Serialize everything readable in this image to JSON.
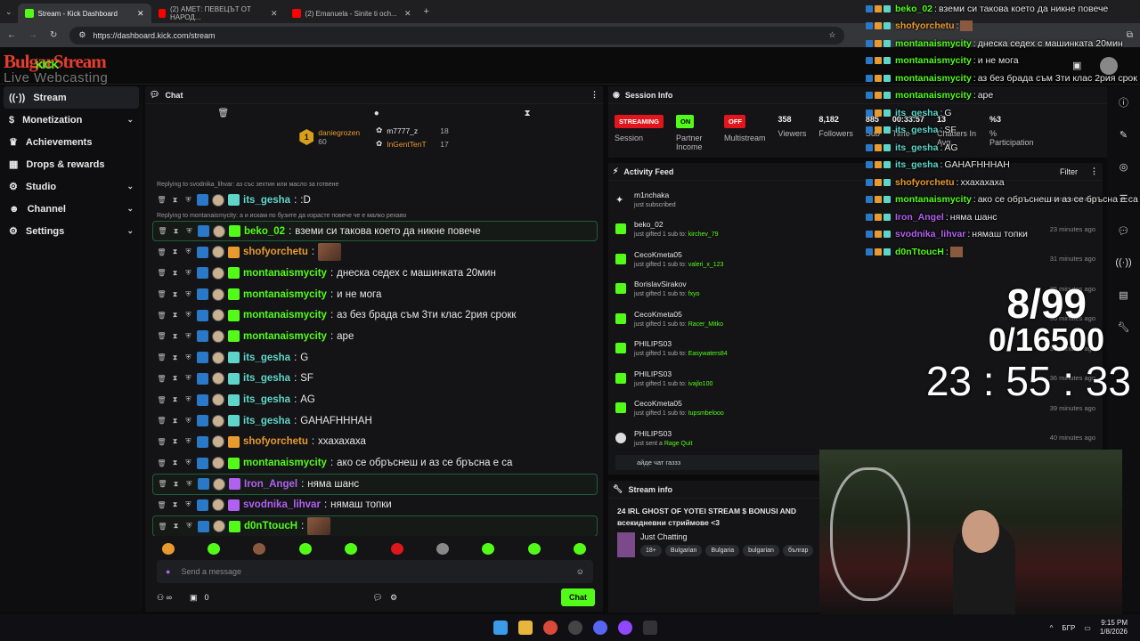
{
  "browser": {
    "tabs": [
      {
        "title": "Stream - Kick Dashboard",
        "active": true
      },
      {
        "title": "(2) АМЕТ: ПЕВЕЦЪТ ОТ НАРОД...",
        "active": false
      },
      {
        "title": "(2) Emanuela - Sinite ti och...",
        "active": false
      }
    ],
    "url": "https://dashboard.kick.com/stream",
    "new_tab": "+"
  },
  "logo": {
    "line1": "BulgarStream",
    "line1_overlay": "KICK",
    "line2": "Live Webcasting Services"
  },
  "sidebar": {
    "items": [
      {
        "label": "Stream",
        "active": true
      },
      {
        "label": "Monetization"
      },
      {
        "label": "Achievements"
      },
      {
        "label": "Drops & rewards"
      },
      {
        "label": "Studio"
      },
      {
        "label": "Channel"
      },
      {
        "label": "Settings"
      }
    ]
  },
  "chat": {
    "title": "Chat",
    "top_gifters": [
      {
        "rank": "1",
        "name": "daniegrozen",
        "amount": "60"
      },
      {
        "name": "m7777_z",
        "amount": "18"
      },
      {
        "name": "InGentTenT",
        "amount": "17"
      }
    ],
    "messages": [
      {
        "reply": "Replying to svodnika_lihvar: аз със зехтин или масло за готвене",
        "user": "its_gesha",
        "color": "#5ed5c8",
        "text": ":D"
      },
      {
        "reply": "Replying to montanaismycity: а и искам по бузите да израсте повече че е малко рехаво",
        "user": "beko_02",
        "color": "#53fc18",
        "text": "вземи си такова което да никне повече",
        "hl": true
      },
      {
        "user": "shofyorchetu",
        "color": "#e89a2e",
        "text": "",
        "emote": true
      },
      {
        "user": "montanaismycity",
        "color": "#53fc18",
        "text": "днеска седех с машинката 20мин"
      },
      {
        "user": "montanaismycity",
        "color": "#53fc18",
        "text": "и не мога"
      },
      {
        "user": "montanaismycity",
        "color": "#53fc18",
        "text": "аз без брада съм 3ти клас 2рия срокк"
      },
      {
        "user": "montanaismycity",
        "color": "#53fc18",
        "text": "аре"
      },
      {
        "user": "its_gesha",
        "color": "#5ed5c8",
        "text": "G"
      },
      {
        "user": "its_gesha",
        "color": "#5ed5c8",
        "text": "SF"
      },
      {
        "user": "its_gesha",
        "color": "#5ed5c8",
        "text": "AG"
      },
      {
        "user": "its_gesha",
        "color": "#5ed5c8",
        "text": "GAHAFHHHAH"
      },
      {
        "user": "shofyorchetu",
        "color": "#e89a2e",
        "text": "ххахахаха"
      },
      {
        "user": "montanaismycity",
        "color": "#53fc18",
        "text": "ако се обръснеш и аз се бръсна е са"
      },
      {
        "user": "Iron_Angel",
        "color": "#b061f0",
        "text": "няма шанс",
        "hl": true
      },
      {
        "user": "svodnika_lihvar",
        "color": "#b061f0",
        "text": "нямаш топки"
      },
      {
        "user": "d0nTtoucH",
        "color": "#53fc18",
        "text": "",
        "emote": true,
        "hl": true
      }
    ],
    "input_placeholder": "Send a message",
    "viewer_count": "0",
    "chat_button": "Chat"
  },
  "session": {
    "title": "Session Info",
    "streaming": "STREAMING",
    "session_label": "Session",
    "partner_state": "ON",
    "partner_label": "Partner Income",
    "multi_state": "OFF",
    "multi_label": "Multistream",
    "viewers": "358",
    "viewers_label": "Viewers",
    "followers": "8,182",
    "followers_label": "Followers",
    "subs": "885",
    "subs_label": "Sub",
    "time": "00:33:57",
    "time_label": "Time",
    "chatters": "13",
    "chatters_label": "Chatters In Avg.",
    "participation": "%3",
    "participation_label": "% Participation"
  },
  "activity": {
    "title": "Activity Feed",
    "filter": "Filter",
    "items": [
      {
        "name": "m1nchaka",
        "action": "just subscribed",
        "target": "",
        "when": "18 minutes ago"
      },
      {
        "name": "beko_02",
        "action": "just gifted 1 sub to:",
        "target": "kirchev_79",
        "when": "23 minutes ago"
      },
      {
        "name": "CecoKmeta05",
        "action": "just gifted 1 sub to:",
        "target": "valeri_x_123",
        "when": "31 minutes ago"
      },
      {
        "name": "BorislavSirakov",
        "action": "just gifted 1 sub to:",
        "target": "fxyo",
        "when": "35 minutes ago"
      },
      {
        "name": "CecoKmeta05",
        "action": "just gifted 1 sub to:",
        "target": "Racer_Mitko",
        "when": "36 minutes ago"
      },
      {
        "name": "PHILIPS03",
        "action": "just gifted 1 sub to:",
        "target": "Easywaters84",
        "when": "36 minutes ago"
      },
      {
        "name": "PHILIPS03",
        "action": "just gifted 1 sub to:",
        "target": "ivajlo100",
        "when": "36 minutes ago"
      },
      {
        "name": "CecoKmeta05",
        "action": "just gifted 1 sub to:",
        "target": "tupsmbelooo",
        "when": "39 minutes ago"
      },
      {
        "name": "PHILIPS03",
        "action": "just sent a",
        "target": "Rage Quit",
        "when": "40 minutes ago"
      }
    ],
    "note": "айде чат газзз"
  },
  "streaminfo": {
    "title": "Stream info",
    "stream_title": "24 IRL GHOST OF YOTEI STREAM $ BONUSI AND всекидневни стриймове <3",
    "category": "Just Chatting",
    "tags": [
      "18+",
      "Bulgarian",
      "Bulgaria",
      "bulgarian",
      "българ"
    ]
  },
  "overlay": {
    "messages": [
      {
        "user": "beko_02",
        "color": "#53fc18",
        "text": "вземи си такова което да никне повече"
      },
      {
        "user": "shofyorchetu",
        "color": "#e89a2e",
        "text": ""
      },
      {
        "user": "montanaismycity",
        "color": "#53fc18",
        "text": "днеска седех с машинката 20мин"
      },
      {
        "user": "montanaismycity",
        "color": "#53fc18",
        "text": "и не мога"
      },
      {
        "user": "montanaismycity",
        "color": "#53fc18",
        "text": "аз без брада съм 3ти клас 2рия срок"
      },
      {
        "user": "montanaismycity",
        "color": "#53fc18",
        "text": "аре"
      },
      {
        "user": "its_gesha",
        "color": "#5ed5c8",
        "text": "G"
      },
      {
        "user": "its_gesha",
        "color": "#5ed5c8",
        "text": "SF"
      },
      {
        "user": "its_gesha",
        "color": "#5ed5c8",
        "text": "AG"
      },
      {
        "user": "its_gesha",
        "color": "#5ed5c8",
        "text": "GAHAFHHHAH"
      },
      {
        "user": "shofyorchetu",
        "color": "#e89a2e",
        "text": "ххахахаха"
      },
      {
        "user": "montanaismycity",
        "color": "#53fc18",
        "text": "ако се обръснеш и аз се бръсна е са"
      },
      {
        "user": "Iron_Angel",
        "color": "#b061f0",
        "text": "няма шанс"
      },
      {
        "user": "svodnika_lihvar",
        "color": "#b061f0",
        "text": "нямаш топки"
      },
      {
        "user": "d0nTtoucH",
        "color": "#53fc18",
        "text": ""
      }
    ],
    "goal_subs": "8/99",
    "goal_total": "0/16500",
    "timer": "23 : 55 : 33"
  },
  "taskbar": {
    "lang": "БГР",
    "time": "9:15 PM",
    "date": "1/8/2026"
  },
  "colors": {
    "accent": "#53fc18",
    "streaming": "#e0161c",
    "on": "#53fc18",
    "off": "#e0161c"
  }
}
